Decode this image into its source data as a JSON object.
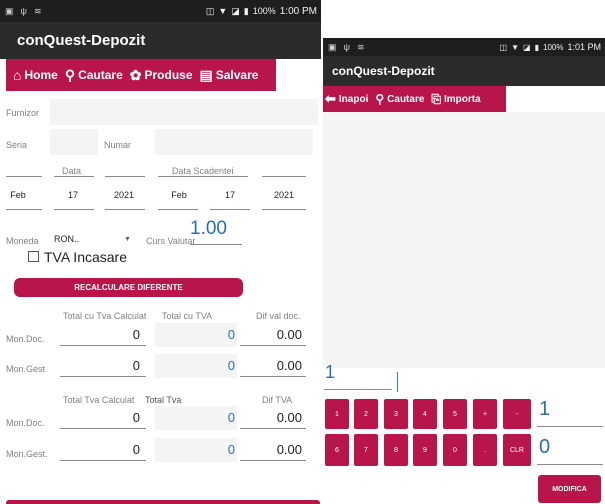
{
  "left": {
    "status": {
      "battery": "100%",
      "time": "1:00 PM"
    },
    "app_title": "conQuest-Depozit",
    "toolbar": {
      "home": "Home",
      "search": "Cautare",
      "products": "Produse",
      "save": "Salvare"
    },
    "form": {
      "supplier_label": "Furnizor",
      "series_label": "Seria",
      "number_label": "Numar",
      "date_label": "Data",
      "due_date_label": "Data Scadentei",
      "date": {
        "month": "Feb",
        "day": "17",
        "year": "2021"
      },
      "due_date": {
        "month": "Feb",
        "day": "17",
        "year": "2021"
      },
      "currency_label": "Moneda",
      "currency_value": "RON..",
      "rate_label": "Curs Valutar",
      "rate_value": "1.00",
      "tva_label": "TVA Incasare",
      "recalc_button": "RECALCULARE DIFERENTE"
    },
    "totals": {
      "headers": [
        "Total cu Tva Calculat",
        "Total cu TVA",
        "Dif val doc."
      ],
      "rows": [
        {
          "label": "Mon.Doc.",
          "calc": "0",
          "doc": "0",
          "diff": "0.00"
        },
        {
          "label": "Mon.Gest",
          "calc": "0",
          "doc": "0",
          "diff": "0.00"
        }
      ]
    },
    "tva": {
      "headers": [
        "Total Tva Calculat",
        "Total Tva",
        "Dif TVA"
      ],
      "rows": [
        {
          "label": "Mon.Doc.",
          "calc": "0",
          "doc": "0",
          "diff": "0.00"
        },
        {
          "label": "Mon.Gest.",
          "calc": "0",
          "doc": "0",
          "diff": "0.00"
        }
      ]
    }
  },
  "right": {
    "status": {
      "battery": "100%",
      "time": "1:01 PM"
    },
    "app_title": "conQuest-Depozit",
    "toolbar": {
      "back": "Inapoi",
      "search": "Cautare",
      "import": "Importa"
    },
    "input_value": "1",
    "keys_row1": [
      "1",
      "2",
      "3",
      "4",
      "5",
      "+",
      "-"
    ],
    "keys_row2": [
      "6",
      "7",
      "8",
      "9",
      "0",
      ".",
      "CLR"
    ],
    "side_value_1": "1",
    "side_value_2": "0",
    "modify_button": "MODIFICA"
  },
  "colors": {
    "accent": "#b8154b",
    "appbar": "#2b2b2b",
    "statusbar": "#1e1e1e",
    "blue_value": "#2a6fb5"
  }
}
